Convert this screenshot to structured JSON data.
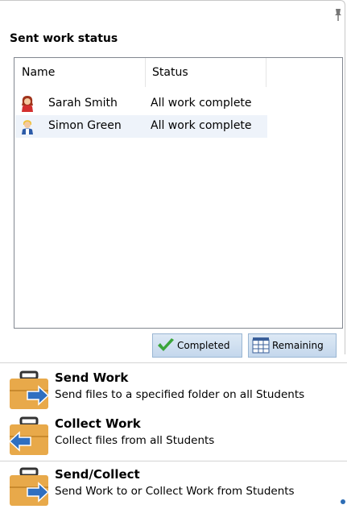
{
  "panel": {
    "title": "Sent work status"
  },
  "list": {
    "columns": [
      "Name",
      "Status"
    ],
    "rows": [
      {
        "name": "Sarah Smith",
        "status": "All work complete",
        "avatar_icon": "student-girl-icon"
      },
      {
        "name": "Simon Green",
        "status": "All work complete",
        "avatar_icon": "student-boy-icon"
      }
    ]
  },
  "legend": {
    "completed_label": "Completed",
    "remaining_label": "Remaining"
  },
  "tasks": [
    {
      "title": "Send Work",
      "description": "Send files to a specified folder on all Students",
      "icon": "send-work-icon"
    },
    {
      "title": "Collect Work",
      "description": "Collect files from all Students",
      "icon": "collect-work-icon"
    },
    {
      "title": "Send/Collect",
      "description": "Send Work to or Collect Work from Students",
      "icon": "send-collect-icon"
    }
  ],
  "colors": {
    "briefcase": "#e8a94a",
    "arrow": "#2f6fc0",
    "check": "#3aa53a",
    "row_highlight": "#eef3fa"
  }
}
